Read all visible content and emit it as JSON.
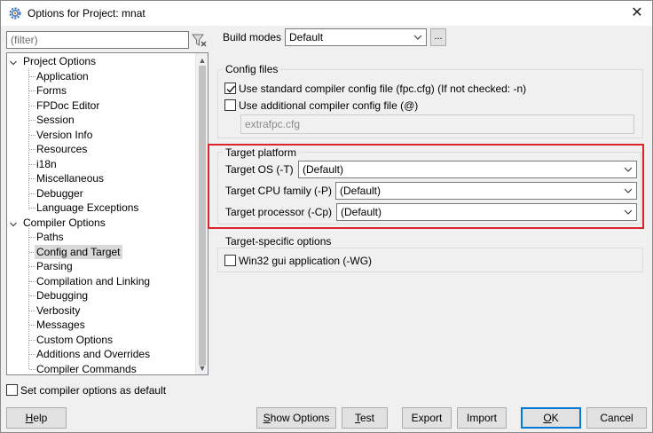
{
  "window": {
    "title": "Options for Project: mnat",
    "close_glyph": "✕",
    "icon": "gear-app-icon"
  },
  "filter": {
    "placeholder": "(filter)",
    "icon": "filter-clear-icon"
  },
  "tree": {
    "groups": [
      {
        "label": "Project Options",
        "items": [
          "Application",
          "Forms",
          "FPDoc Editor",
          "Session",
          "Version Info",
          "Resources",
          "i18n",
          "Miscellaneous",
          "Debugger",
          "Language Exceptions"
        ]
      },
      {
        "label": "Compiler Options",
        "items": [
          "Paths",
          "Config and Target",
          "Parsing",
          "Compilation and Linking",
          "Debugging",
          "Verbosity",
          "Messages",
          "Custom Options",
          "Additions and Overrides",
          "Compiler Commands"
        ]
      }
    ],
    "selected": "Config and Target"
  },
  "build_modes": {
    "label": "Build modes",
    "value": "Default",
    "more": "..."
  },
  "config_files": {
    "title": "Config files",
    "use_standard": {
      "label": "Use standard compiler config file (fpc.cfg) (If not checked: -n)",
      "checked": true
    },
    "use_additional": {
      "label": "Use additional compiler config file (@)",
      "checked": false
    },
    "additional_file": "extrafpc.cfg"
  },
  "target_platform": {
    "title": "Target platform",
    "os": {
      "label": "Target OS (-T)",
      "value": "(Default)"
    },
    "cpu": {
      "label": "Target CPU family (-P)",
      "value": "(Default)"
    },
    "processor": {
      "label": "Target processor (-Cp)",
      "value": "(Default)"
    },
    "highlight_color": "#d9242c"
  },
  "target_specific": {
    "title": "Target-specific options",
    "win32gui": {
      "label": "Win32 gui application (-WG)",
      "checked": false
    }
  },
  "set_default": {
    "label": "Set compiler options as default",
    "checked": false
  },
  "buttons": {
    "help": {
      "u": "H",
      "rest": "elp"
    },
    "show_options": {
      "u": "S",
      "rest": "how Options"
    },
    "test": {
      "u": "T",
      "rest": "est"
    },
    "export": "Export",
    "import": "Import",
    "ok": {
      "u": "O",
      "rest": "K"
    },
    "cancel": "Cancel"
  }
}
